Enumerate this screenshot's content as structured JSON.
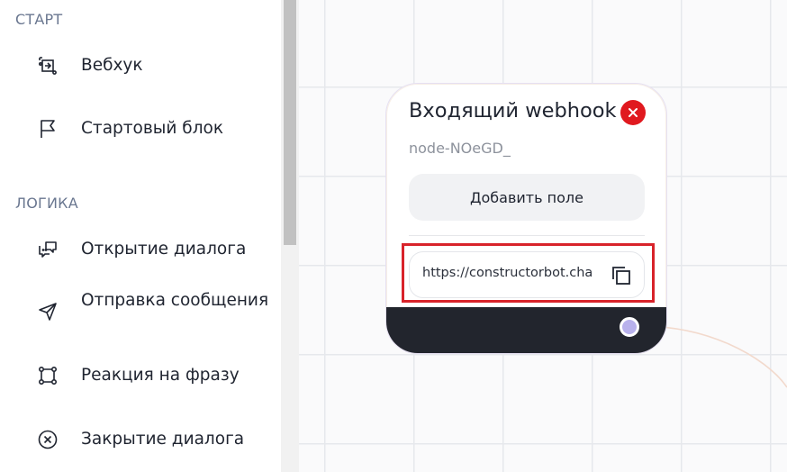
{
  "sidebar": {
    "sections": [
      {
        "title": "СТАРТ",
        "items": [
          {
            "label": "Вебхук",
            "icon": "webhook-icon"
          },
          {
            "label": "Стартовый блок",
            "icon": "flag-icon"
          }
        ]
      },
      {
        "title": "ЛОГИКА",
        "items": [
          {
            "label": "Открытие диалога",
            "icon": "open-dialog-icon"
          },
          {
            "label": "Отправка сообщения",
            "icon": "send-icon"
          },
          {
            "label": "Реакция на фразу",
            "icon": "phrase-reaction-icon"
          },
          {
            "label": "Закрытие диалога",
            "icon": "close-dialog-icon"
          }
        ]
      }
    ]
  },
  "node": {
    "title": "Входящий webhook",
    "id": "node-NOeGD_",
    "add_field_label": "Добавить поле",
    "url_value": "https://constructorbot.cha"
  },
  "colors": {
    "accent_red": "#e0191f",
    "footer_dark": "#22252d",
    "port": "#b8b1ec",
    "highlight": "#d8232a"
  }
}
